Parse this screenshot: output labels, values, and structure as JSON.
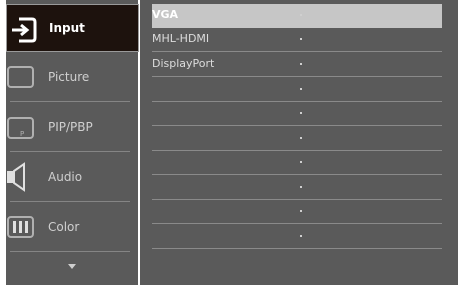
{
  "sidebar": {
    "items": [
      {
        "label": "Input"
      },
      {
        "label": "Picture"
      },
      {
        "label": "PIP/PBP"
      },
      {
        "label": "Audio"
      },
      {
        "label": "Color"
      }
    ]
  },
  "submenu": {
    "options": [
      {
        "label": "VGA"
      },
      {
        "label": "MHL-HDMI"
      },
      {
        "label": "DisplayPort"
      },
      {
        "label": ""
      },
      {
        "label": ""
      },
      {
        "label": ""
      },
      {
        "label": ""
      },
      {
        "label": ""
      },
      {
        "label": ""
      },
      {
        "label": ""
      }
    ],
    "selected": "VGA"
  },
  "colors": {
    "panel": "#5a5a5a",
    "active_item": "#1d120d",
    "selected_row": "#c6c6c6"
  }
}
